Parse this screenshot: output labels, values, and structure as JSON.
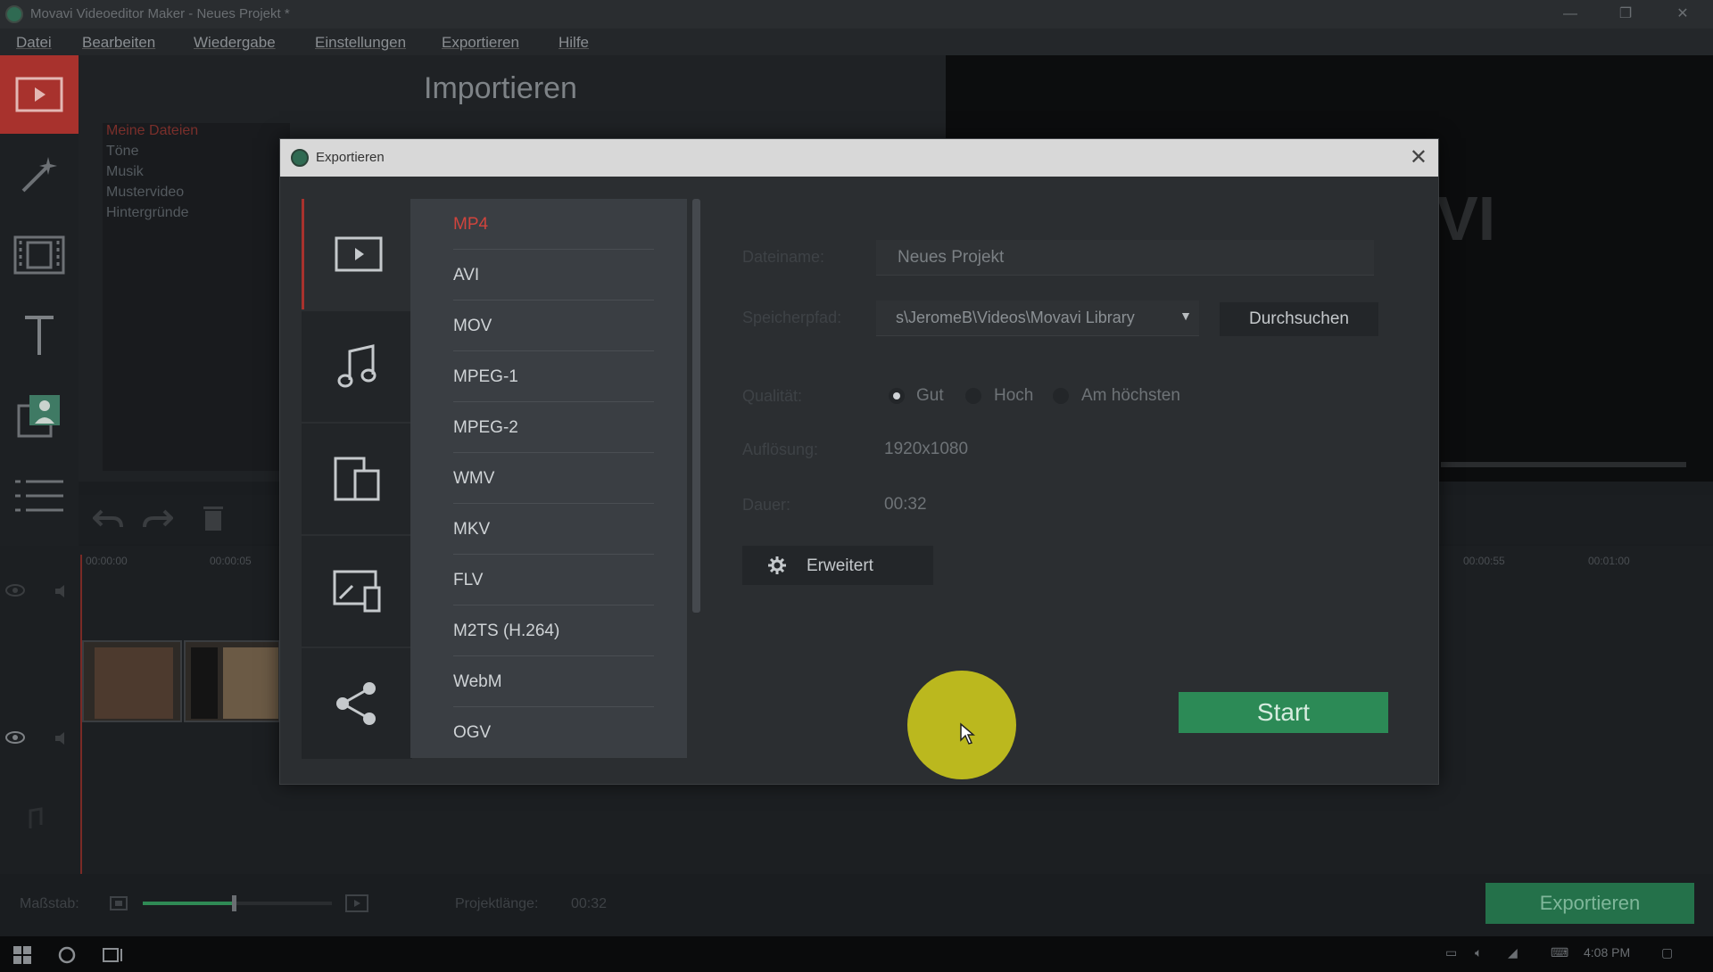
{
  "window": {
    "title": "Movavi Videoeditor Maker - Neues Projekt *",
    "min": "—",
    "max": "❐",
    "close": "✕"
  },
  "menu": [
    "Datei",
    "Bearbeiten",
    "Wiedergabe",
    "Einstellungen",
    "Exportieren",
    "Hilfe"
  ],
  "sidebar": {
    "items": [
      "import-icon",
      "magic-wand-icon",
      "filmstrip-icon",
      "text-icon",
      "chroma-key-icon",
      "menu-icon"
    ]
  },
  "import": {
    "title": "Importieren",
    "categories": [
      "Meine Dateien",
      "Töne",
      "Musik",
      "Mustervideo",
      "Hintergründe"
    ]
  },
  "preview": {
    "bg_letters": "VI"
  },
  "timeline": {
    "ruler": [
      "00:00:00",
      "00:00:05",
      "00:00:55",
      "00:01:00"
    ]
  },
  "bottom": {
    "scale_label": "Maßstab:",
    "project_length_label": "Projektlänge:",
    "project_length": "00:32",
    "scale_level": 0.48,
    "export_button": "Exportieren"
  },
  "taskbar": {
    "time": "4:08 PM"
  },
  "dialog": {
    "title": "Exportieren",
    "close": "✕",
    "category_tabs": [
      "video-icon",
      "music-note-icon",
      "devices-icon",
      "tv-device-icon",
      "share-icon"
    ],
    "formats": [
      "MP4",
      "AVI",
      "MOV",
      "MPEG-1",
      "MPEG-2",
      "WMV",
      "MKV",
      "FLV",
      "M2TS (H.264)",
      "WebM",
      "OGV"
    ],
    "selected_format": "MP4",
    "fields": {
      "filename_label": "Dateiname:",
      "filename_value": "Neues Projekt",
      "path_label": "Speicherpfad:",
      "path_value": "s\\JeromeB\\Videos\\Movavi Library",
      "browse_button": "Durchsuchen",
      "quality_label": "Qualität:",
      "quality_options": [
        "Gut",
        "Hoch",
        "Am höchsten"
      ],
      "quality_selected": "Gut",
      "resolution_label": "Auflösung:",
      "resolution_value": "1920x1080",
      "duration_label": "Dauer:",
      "duration_value": "00:32"
    },
    "advanced_button": "Erweitert",
    "start_button": "Start"
  },
  "colors": {
    "accent_red": "#a8322d",
    "start_green": "#2c8a56",
    "export_green": "#24714a",
    "cursor_highlight": "#c8c41c"
  }
}
